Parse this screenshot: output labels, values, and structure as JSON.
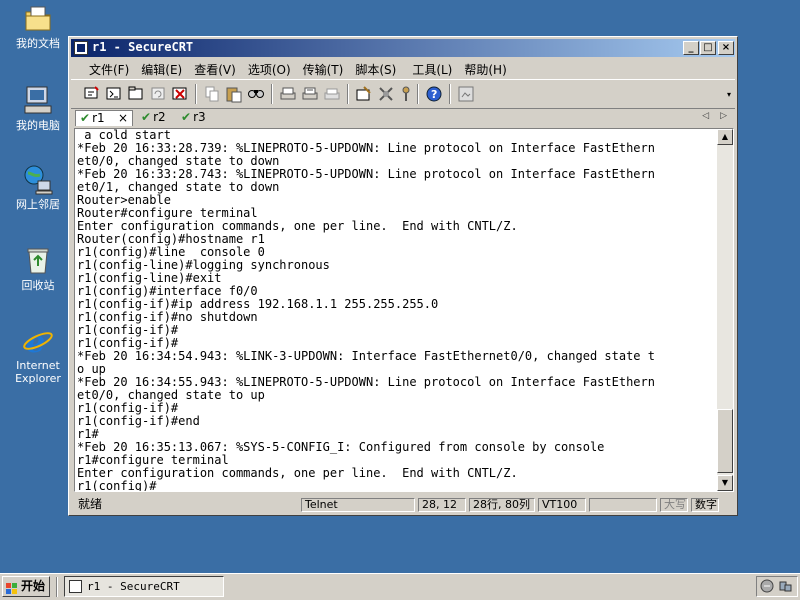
{
  "desktop": {
    "icons": [
      {
        "label": "我的文档",
        "icon": "my-documents-icon"
      },
      {
        "label": "我的电脑",
        "icon": "my-computer-icon"
      },
      {
        "label": "网上邻居",
        "icon": "network-places-icon"
      },
      {
        "label": "回收站",
        "icon": "recycle-bin-icon"
      },
      {
        "label": "Internet Explorer",
        "icon": "internet-explorer-icon"
      }
    ]
  },
  "window": {
    "title": "r1 - SecureCRT",
    "controls": {
      "minimize": "_",
      "maximize": "□",
      "close": "×"
    }
  },
  "menu": [
    "文件(F)",
    "编辑(E)",
    "查看(V)",
    "选项(O)",
    "传输(T)",
    "脚本(S)",
    "工具(L)",
    "帮助(H)"
  ],
  "toolbar": {
    "buttons": [
      "connect-icon",
      "quick-connect-icon",
      "connect-tab-icon",
      "reconnect-icon",
      "disconnect-icon",
      "copy-icon",
      "paste-icon",
      "find-icon",
      "print-icon",
      "print-selection-icon",
      "print-setup-icon",
      "session-options-icon",
      "global-options-icon",
      "keymap-icon",
      "help-icon",
      "sftp-icon"
    ]
  },
  "tabs": [
    {
      "label": "r1",
      "active": true,
      "close": "×"
    },
    {
      "label": "r2",
      "active": false
    },
    {
      "label": "r3",
      "active": false
    }
  ],
  "tab_nav": {
    "prev": "◁",
    "next": "▷"
  },
  "terminal": {
    "lines": [
      " a cold start",
      "*Feb 20 16:33:28.739: %LINEPROTO-5-UPDOWN: Line protocol on Interface FastEthern",
      "et0/0, changed state to down",
      "*Feb 20 16:33:28.743: %LINEPROTO-5-UPDOWN: Line protocol on Interface FastEthern",
      "et0/1, changed state to down",
      "Router>enable",
      "Router#configure terminal",
      "Enter configuration commands, one per line.  End with CNTL/Z.",
      "Router(config)#hostname r1",
      "r1(config)#line  console 0",
      "r1(config-line)#logging synchronous",
      "r1(config-line)#exit",
      "r1(config)#interface f0/0",
      "r1(config-if)#ip address 192.168.1.1 255.255.255.0",
      "r1(config-if)#no shutdown",
      "r1(config-if)#",
      "r1(config-if)#",
      "*Feb 20 16:34:54.943: %LINK-3-UPDOWN: Interface FastEthernet0/0, changed state t",
      "o up",
      "*Feb 20 16:34:55.943: %LINEPROTO-5-UPDOWN: Line protocol on Interface FastEthern",
      "et0/0, changed state to up",
      "r1(config-if)#",
      "r1(config-if)#end",
      "r1#",
      "*Feb 20 16:35:13.067: %SYS-5-CONFIG_I: Configured from console by console",
      "r1#configure terminal",
      "Enter configuration commands, one per line.  End with CNTL/Z.",
      "r1(config)#"
    ]
  },
  "status": {
    "ready": "就绪",
    "protocol": "Telnet",
    "cursor": "28, 12",
    "size": "28行, 80列",
    "emulation": "VT100",
    "caps": "大写",
    "num": "数字"
  },
  "taskbar": {
    "start": "开始",
    "task": "r1 - SecureCRT"
  }
}
